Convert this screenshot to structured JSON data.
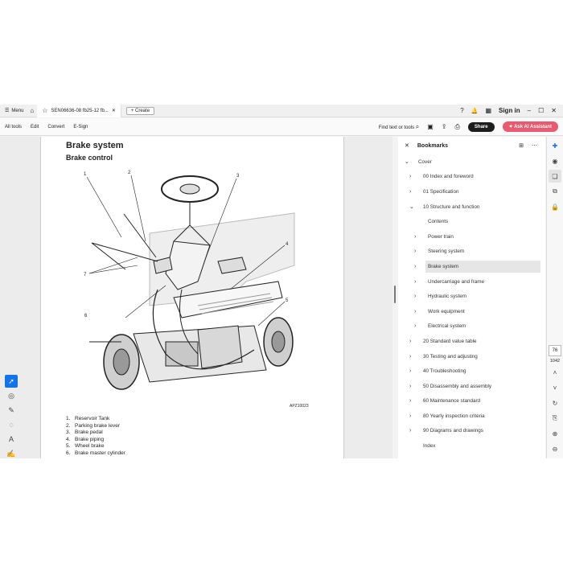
{
  "titlebar": {
    "menu_label": "Menu",
    "tab_title": "SEN06636-08 fb25-12 fb...",
    "create_label": "Create",
    "sign_in": "Sign in"
  },
  "toolbar": {
    "items": [
      "All tools",
      "Edit",
      "Convert",
      "E-Sign"
    ],
    "find_label": "Find text or tools",
    "share_label": "Share",
    "ai_label": "Ask AI Assistant"
  },
  "document": {
    "title": "Brake system",
    "subtitle": "Brake control",
    "figure_code": "APZ10023",
    "callouts": [
      "1",
      "2",
      "3",
      "4",
      "5",
      "6",
      "7"
    ],
    "legend": [
      {
        "n": "1.",
        "text": "Reservoir Tank"
      },
      {
        "n": "2.",
        "text": "Parking brake lever"
      },
      {
        "n": "3.",
        "text": "Brake pedal"
      },
      {
        "n": "4.",
        "text": "Brake piping"
      },
      {
        "n": "5.",
        "text": "Wheel brake"
      },
      {
        "n": "6.",
        "text": "Brake master cylinder"
      }
    ]
  },
  "bookmarks": {
    "title": "Bookmarks",
    "items": [
      {
        "label": "Cover",
        "level": 0,
        "chevron": "down"
      },
      {
        "label": "00 Index and foreword",
        "level": 1,
        "chevron": "right"
      },
      {
        "label": "01 Specification",
        "level": 1,
        "chevron": "right"
      },
      {
        "label": "10 Structure and function",
        "level": 1,
        "chevron": "down"
      },
      {
        "label": "Contents",
        "level": 2,
        "chevron": ""
      },
      {
        "label": "Power train",
        "level": 2,
        "chevron": "right"
      },
      {
        "label": "Steering system",
        "level": 2,
        "chevron": "right"
      },
      {
        "label": "Brake system",
        "level": 2,
        "chevron": "right",
        "selected": true
      },
      {
        "label": "Undercarriage and frame",
        "level": 2,
        "chevron": "right"
      },
      {
        "label": "Hydraulic system",
        "level": 2,
        "chevron": "right"
      },
      {
        "label": "Work equipment",
        "level": 2,
        "chevron": "right"
      },
      {
        "label": "Electrical system",
        "level": 2,
        "chevron": "right"
      },
      {
        "label": "20 Standard value table",
        "level": 1,
        "chevron": "right"
      },
      {
        "label": "30 Testing and adjusting",
        "level": 1,
        "chevron": "right"
      },
      {
        "label": "40 Troubleshooting",
        "level": 1,
        "chevron": "right"
      },
      {
        "label": "50 Disassembly and assembly",
        "level": 1,
        "chevron": "right"
      },
      {
        "label": "60 Maintenance standard",
        "level": 1,
        "chevron": "right"
      },
      {
        "label": "80 Yearly inspection criteria",
        "level": 1,
        "chevron": "right"
      },
      {
        "label": "90 Diagrams and drawings",
        "level": 1,
        "chevron": "right"
      },
      {
        "label": "Index",
        "level": 1,
        "chevron": ""
      }
    ]
  },
  "pager": {
    "current": "76",
    "total": "1042"
  },
  "colors": {
    "accent": "#1473e6",
    "ai": "#e95a6e",
    "share": "#1d1d1d"
  }
}
